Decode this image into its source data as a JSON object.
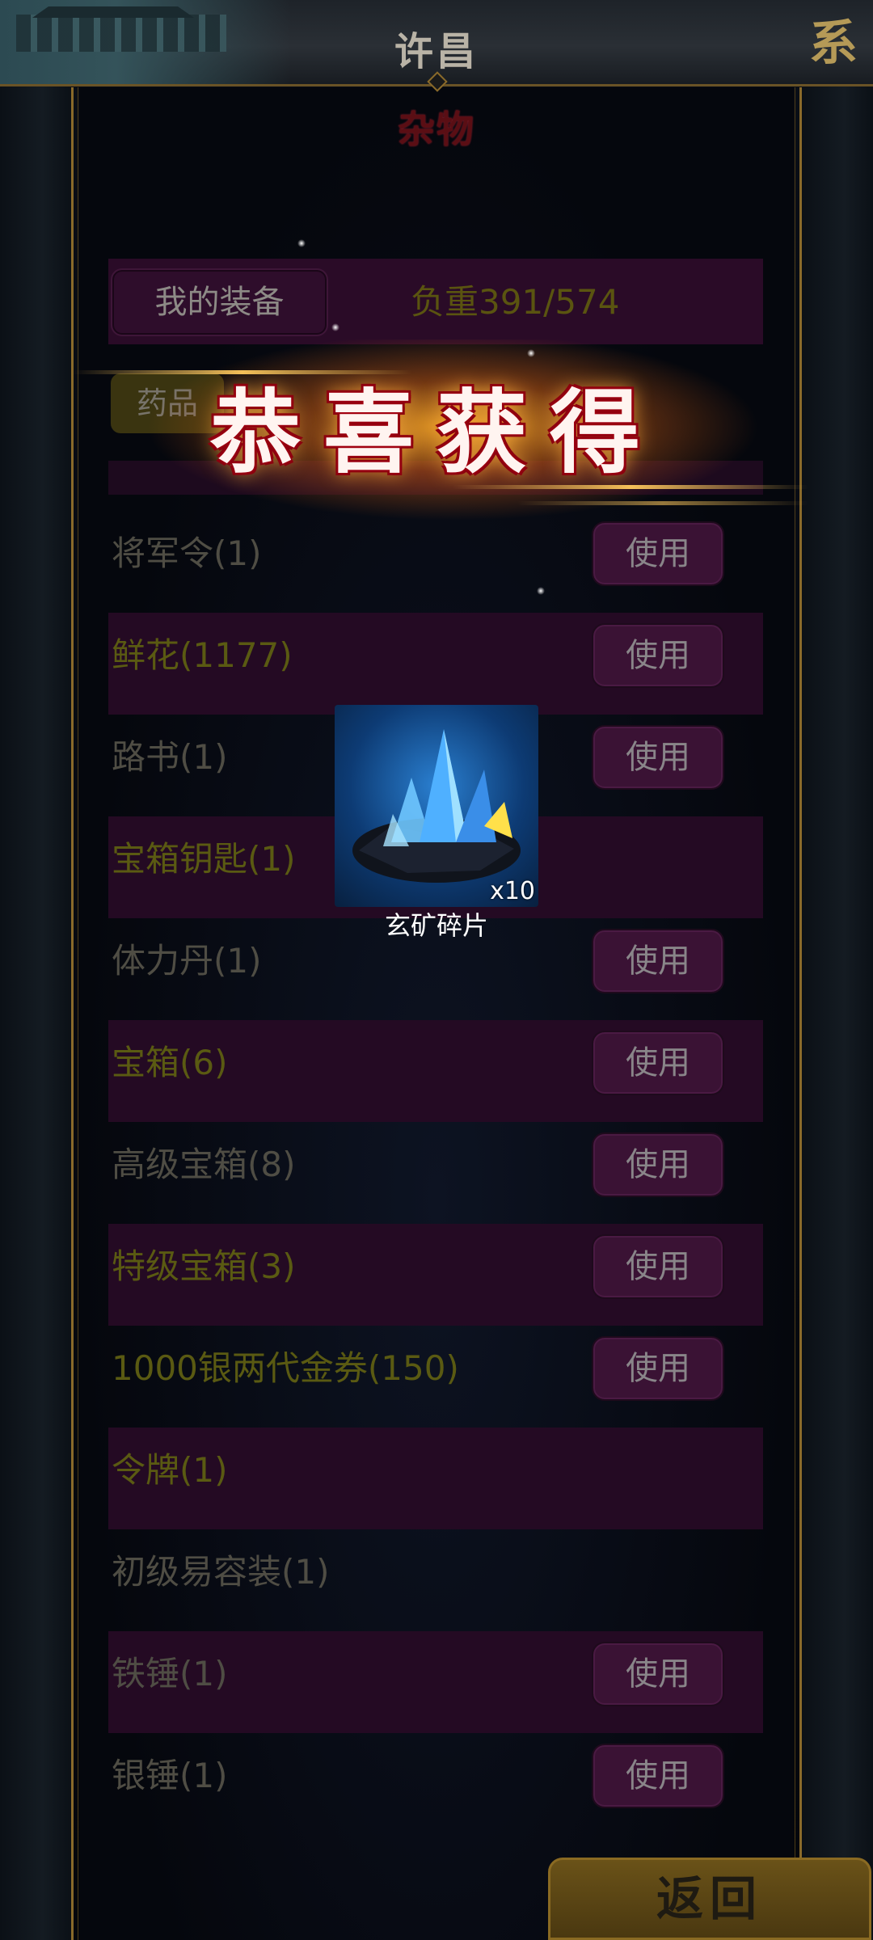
{
  "header": {
    "town": "许昌",
    "system_button": "系"
  },
  "category_title": "杂物",
  "toolbar": {
    "equipment_button": "我的装备",
    "weight": "负重391/574",
    "medicine_tab": "药品"
  },
  "items": [
    {
      "name": "将军令(1)",
      "action": "使用"
    },
    {
      "name": "鲜花(1177)",
      "action": "使用"
    },
    {
      "name": "路书(1)",
      "action": "使用"
    },
    {
      "name": "宝箱钥匙(1)",
      "action": ""
    },
    {
      "name": "体力丹(1)",
      "action": "使用"
    },
    {
      "name": "宝箱(6)",
      "action": "使用"
    },
    {
      "name": "高级宝箱(8)",
      "action": "使用"
    },
    {
      "name": "特级宝箱(3)",
      "action": "使用"
    },
    {
      "name": "1000银两代金券(150)",
      "action": "使用"
    },
    {
      "name": "令牌(1)",
      "action": ""
    },
    {
      "name": "初级易容装(1)",
      "action": ""
    },
    {
      "name": "铁锤(1)",
      "action": "使用"
    },
    {
      "name": "银锤(1)",
      "action": "使用"
    }
  ],
  "reward_popup": {
    "banner": "恭喜获得",
    "item_name": "玄矿碎片",
    "quantity": "x10",
    "icon": "crystal-ore-icon"
  },
  "footer": {
    "back_button": "返回"
  },
  "colors": {
    "panel_row": "#240a23",
    "item_text": "#5a5a12",
    "gold_border": "#8a6a2a"
  }
}
